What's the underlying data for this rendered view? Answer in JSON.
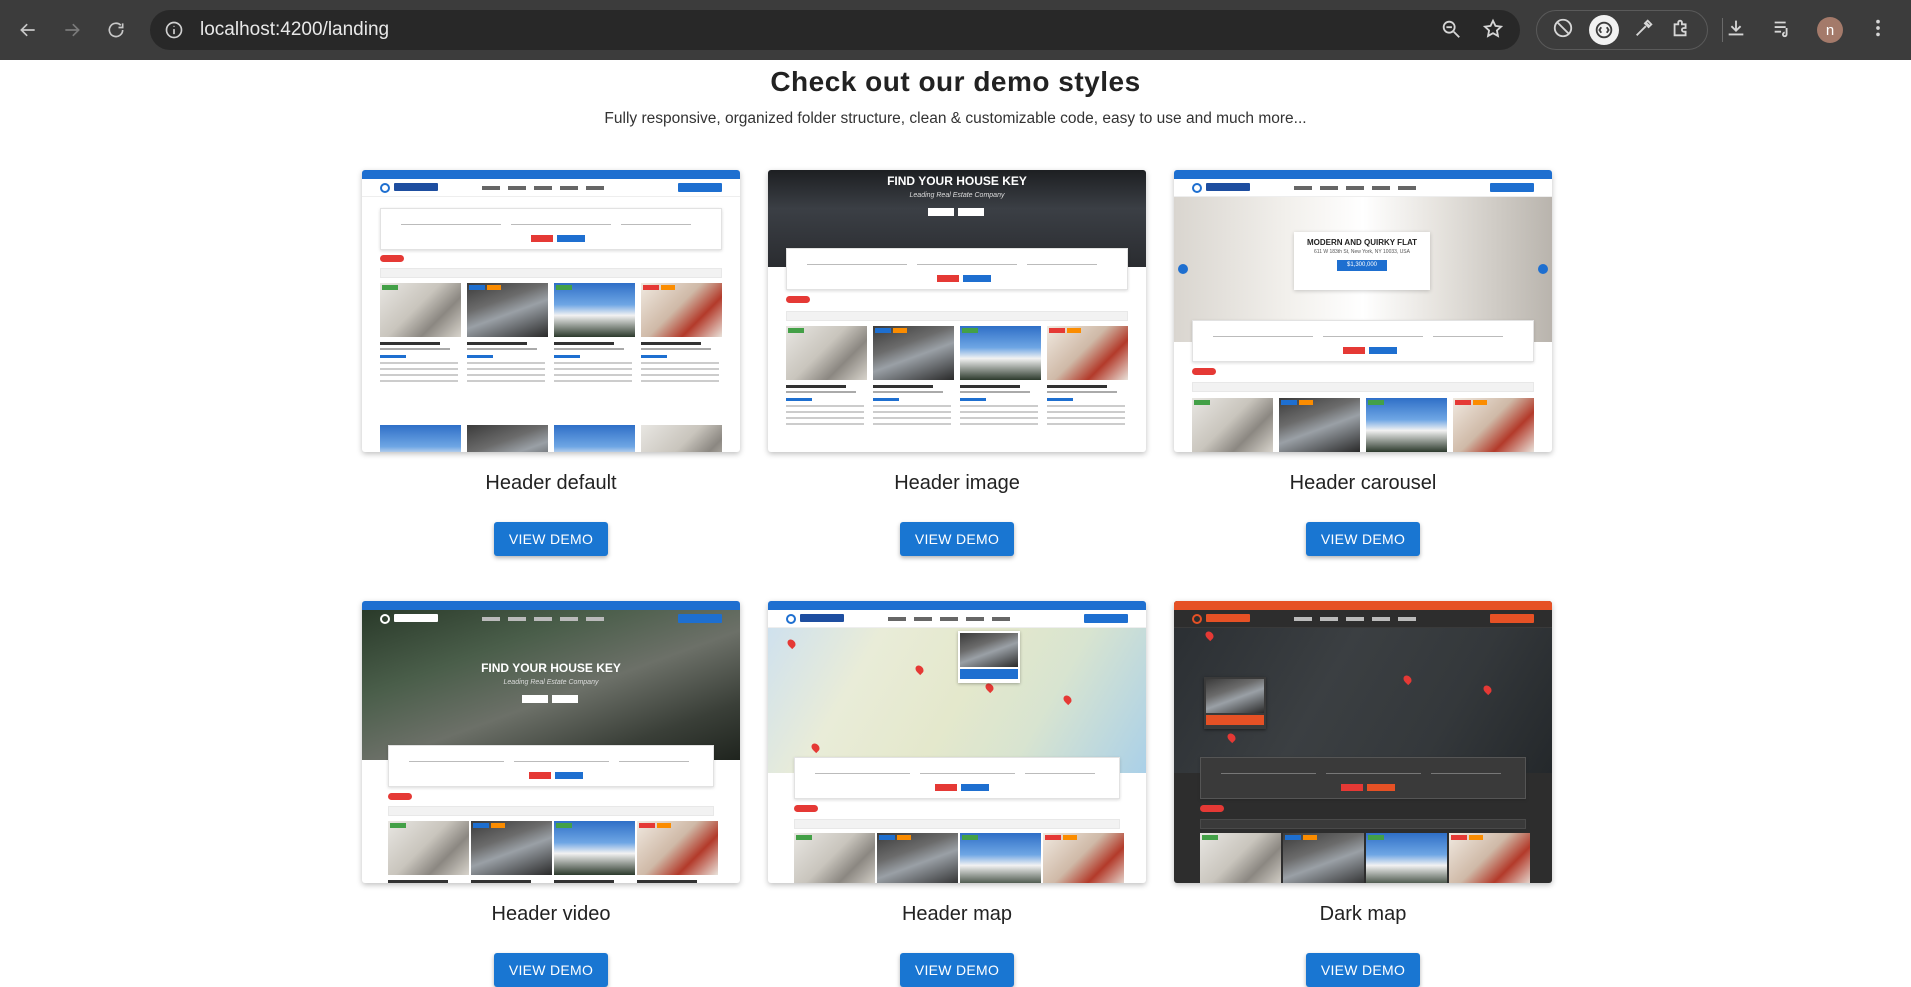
{
  "browser": {
    "url": "localhost:4200/landing",
    "profile_initial": "n",
    "icons": [
      "back-icon",
      "forward-icon",
      "reload-icon",
      "site-info-icon",
      "zoom-icon",
      "bookmark-star-icon",
      "extension-blocked-icon",
      "extension-active-icon",
      "eyedropper-icon",
      "extensions-puzzle-icon",
      "downloads-icon",
      "media-controls-icon"
    ]
  },
  "header": {
    "title": "Check out our demo styles",
    "subtitle": "Fully responsive, organized folder structure, clean & customizable code, easy to use and much more..."
  },
  "demos": [
    {
      "label": "Header default",
      "button": "VIEW DEMO"
    },
    {
      "label": "Header image",
      "button": "VIEW DEMO",
      "hero_title": "FIND YOUR HOUSE KEY",
      "hero_sub": "Leading Real Estate Company"
    },
    {
      "label": "Header carousel",
      "button": "VIEW DEMO",
      "slide_title": "MODERN AND QUIRKY FLAT",
      "slide_address": "611 W 183th St, New York, NY 10033, USA",
      "slide_price": "$1,300,000"
    },
    {
      "label": "Header video",
      "button": "VIEW DEMO",
      "hero_title": "FIND YOUR HOUSE KEY",
      "hero_sub": "Leading Real Estate Company"
    },
    {
      "label": "Header map",
      "button": "VIEW DEMO"
    },
    {
      "label": "Dark map",
      "button": "VIEW DEMO"
    }
  ],
  "colors": {
    "primary": "#1976d2",
    "accent_red": "#e53935",
    "dark_accent": "#e65125"
  }
}
